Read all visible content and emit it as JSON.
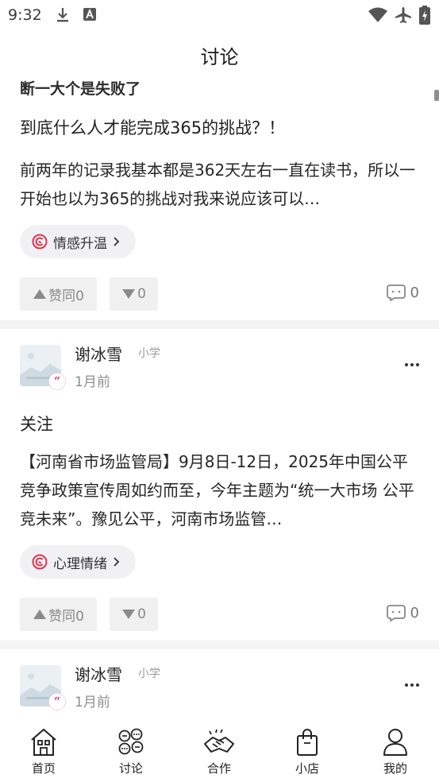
{
  "status": {
    "time": "9:32"
  },
  "header": {
    "title": "讨论"
  },
  "posts": [
    {
      "partial_title": "断一大个是失败了",
      "title": "到底什么人才能完成365的挑战？！",
      "excerpt": "前两年的记录我基本都是362天左右一直在读书，所以一开始也以为365的挑战对我来说应该可以…",
      "tag": "情感升温",
      "agree_label": "赞同0",
      "disagree_label": "0",
      "comments": "0"
    },
    {
      "author": "谢冰雪",
      "level": "小学",
      "time": "1月前",
      "title": "关注",
      "excerpt": "【河南省市场监管局】9月8日-12日，2025年中国公平竞争政策宣传周如约而至，今年主题为“统一大市场 公平竞未来”。豫见公平，河南市场监管…",
      "tag": "心理情绪",
      "agree_label": "赞同0",
      "disagree_label": "0",
      "comments": "0"
    },
    {
      "author": "谢冰雪",
      "level": "小学",
      "time": "1月前"
    }
  ],
  "tabs": [
    {
      "label": "首页",
      "icon": "home-icon"
    },
    {
      "label": "讨论",
      "icon": "discussion-icon"
    },
    {
      "label": "合作",
      "icon": "cooperation-icon"
    },
    {
      "label": "小店",
      "icon": "shop-bag-icon"
    },
    {
      "label": "我的",
      "icon": "profile-icon"
    }
  ],
  "colors": {
    "tag_icon": "#e0344b",
    "chip_bg": "#f1f1f4",
    "divider": "#f4f4f4"
  }
}
